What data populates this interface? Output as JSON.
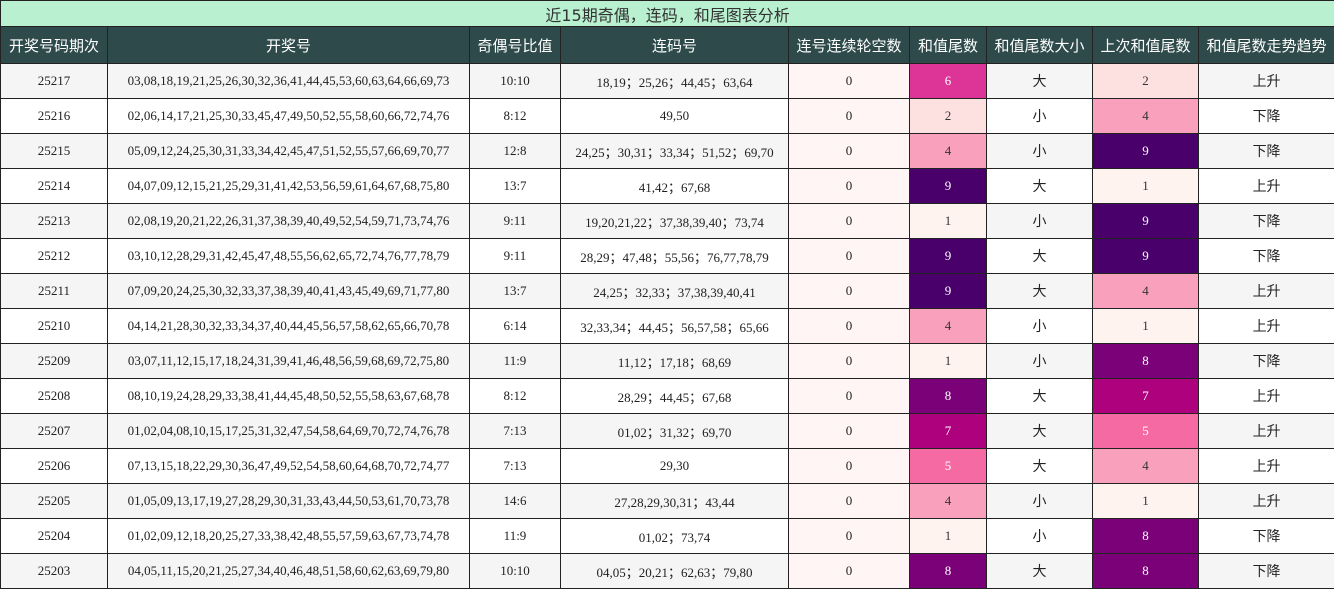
{
  "title": "近15期奇偶，连码，和尾图表分析",
  "headers": [
    "开奖号码期次",
    "开奖号",
    "奇偶号比值",
    "连码号",
    "连号连续轮空数",
    "和值尾数",
    "和值尾数大小",
    "上次和值尾数",
    "和值尾数走势趋势"
  ],
  "colors": {
    "0": "#fff2f0",
    "1": "#fff3f0",
    "2": "#fde0e0",
    "3": "#fcc4cf",
    "4": "#f9a1bc",
    "5": "#f66aa4",
    "6": "#dd3497",
    "7": "#ae017e",
    "8": "#7a0177",
    "9": "#49006a"
  },
  "rows": [
    {
      "period": "25217",
      "numbers": "03,08,18,19,21,25,26,30,32,36,41,44,45,53,60,63,64,66,69,73",
      "odd_even": "10:10",
      "consecutive": "18,19；25,26；44,45；63,64",
      "streak": "0",
      "tail": "6",
      "size": "大",
      "prev_tail": "2",
      "trend": "上升"
    },
    {
      "period": "25216",
      "numbers": "02,06,14,17,21,25,30,33,45,47,49,50,52,55,58,60,66,72,74,76",
      "odd_even": "8:12",
      "consecutive": "49,50",
      "streak": "0",
      "tail": "2",
      "size": "小",
      "prev_tail": "4",
      "trend": "下降"
    },
    {
      "period": "25215",
      "numbers": "05,09,12,24,25,30,31,33,34,42,45,47,51,52,55,57,66,69,70,77",
      "odd_even": "12:8",
      "consecutive": "24,25；30,31；33,34；51,52；69,70",
      "streak": "0",
      "tail": "4",
      "size": "小",
      "prev_tail": "9",
      "trend": "下降"
    },
    {
      "period": "25214",
      "numbers": "04,07,09,12,15,21,25,29,31,41,42,53,56,59,61,64,67,68,75,80",
      "odd_even": "13:7",
      "consecutive": "41,42；67,68",
      "streak": "0",
      "tail": "9",
      "size": "大",
      "prev_tail": "1",
      "trend": "上升"
    },
    {
      "period": "25213",
      "numbers": "02,08,19,20,21,22,26,31,37,38,39,40,49,52,54,59,71,73,74,76",
      "odd_even": "9:11",
      "consecutive": "19,20,21,22；37,38,39,40；73,74",
      "streak": "0",
      "tail": "1",
      "size": "小",
      "prev_tail": "9",
      "trend": "下降"
    },
    {
      "period": "25212",
      "numbers": "03,10,12,28,29,31,42,45,47,48,55,56,62,65,72,74,76,77,78,79",
      "odd_even": "9:11",
      "consecutive": "28,29；47,48；55,56；76,77,78,79",
      "streak": "0",
      "tail": "9",
      "size": "大",
      "prev_tail": "9",
      "trend": "下降"
    },
    {
      "period": "25211",
      "numbers": "07,09,20,24,25,30,32,33,37,38,39,40,41,43,45,49,69,71,77,80",
      "odd_even": "13:7",
      "consecutive": "24,25；32,33；37,38,39,40,41",
      "streak": "0",
      "tail": "9",
      "size": "大",
      "prev_tail": "4",
      "trend": "上升"
    },
    {
      "period": "25210",
      "numbers": "04,14,21,28,30,32,33,34,37,40,44,45,56,57,58,62,65,66,70,78",
      "odd_even": "6:14",
      "consecutive": "32,33,34；44,45；56,57,58；65,66",
      "streak": "0",
      "tail": "4",
      "size": "小",
      "prev_tail": "1",
      "trend": "上升"
    },
    {
      "period": "25209",
      "numbers": "03,07,11,12,15,17,18,24,31,39,41,46,48,56,59,68,69,72,75,80",
      "odd_even": "11:9",
      "consecutive": "11,12；17,18；68,69",
      "streak": "0",
      "tail": "1",
      "size": "小",
      "prev_tail": "8",
      "trend": "下降"
    },
    {
      "period": "25208",
      "numbers": "08,10,19,24,28,29,33,38,41,44,45,48,50,52,55,58,63,67,68,78",
      "odd_even": "8:12",
      "consecutive": "28,29；44,45；67,68",
      "streak": "0",
      "tail": "8",
      "size": "大",
      "prev_tail": "7",
      "trend": "上升"
    },
    {
      "period": "25207",
      "numbers": "01,02,04,08,10,15,17,25,31,32,47,54,58,64,69,70,72,74,76,78",
      "odd_even": "7:13",
      "consecutive": "01,02；31,32；69,70",
      "streak": "0",
      "tail": "7",
      "size": "大",
      "prev_tail": "5",
      "trend": "上升"
    },
    {
      "period": "25206",
      "numbers": "07,13,15,18,22,29,30,36,47,49,52,54,58,60,64,68,70,72,74,77",
      "odd_even": "7:13",
      "consecutive": "29,30",
      "streak": "0",
      "tail": "5",
      "size": "大",
      "prev_tail": "4",
      "trend": "上升"
    },
    {
      "period": "25205",
      "numbers": "01,05,09,13,17,19,27,28,29,30,31,33,43,44,50,53,61,70,73,78",
      "odd_even": "14:6",
      "consecutive": "27,28,29,30,31；43,44",
      "streak": "0",
      "tail": "4",
      "size": "小",
      "prev_tail": "1",
      "trend": "上升"
    },
    {
      "period": "25204",
      "numbers": "01,02,09,12,18,20,25,27,33,38,42,48,55,57,59,63,67,73,74,78",
      "odd_even": "11:9",
      "consecutive": "01,02；73,74",
      "streak": "0",
      "tail": "1",
      "size": "小",
      "prev_tail": "8",
      "trend": "下降"
    },
    {
      "period": "25203",
      "numbers": "04,05,11,15,20,21,25,27,34,40,46,48,51,58,60,62,63,69,79,80",
      "odd_even": "10:10",
      "consecutive": "04,05；20,21；62,63；79,80",
      "streak": "0",
      "tail": "8",
      "size": "大",
      "prev_tail": "8",
      "trend": "下降"
    }
  ]
}
